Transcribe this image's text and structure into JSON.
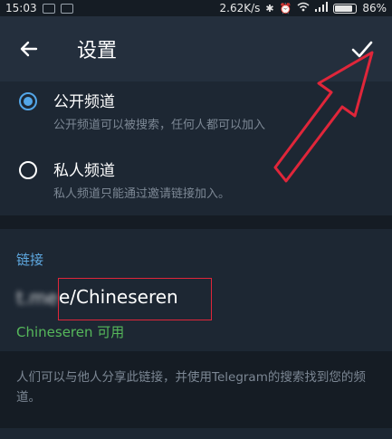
{
  "status_bar": {
    "time": "15:03",
    "speed": "2.62K/s",
    "battery": "86%",
    "battery_level": 0.86
  },
  "header": {
    "title": "设置",
    "back_icon": "arrow-left-icon",
    "confirm_icon": "check-icon"
  },
  "channel_type": {
    "options": [
      {
        "title": "公开频道",
        "desc": "公开频道可以被搜索，任何人都可以加入",
        "checked": true
      },
      {
        "title": "私人频道",
        "desc": "私人频道只能通过邀请链接加入。",
        "checked": false
      }
    ]
  },
  "link": {
    "header": "链接",
    "prefix": "t.me",
    "value": "e/Chineseren",
    "availability": "Chineseren 可用",
    "info": "人们可以与他人分享此链接，并使用Telegram的搜索找到您的频道。"
  },
  "colors": {
    "accent": "#53a6e8",
    "link_header": "#5ea8e0",
    "available": "#56b85b",
    "annotation": "#e0263a"
  }
}
